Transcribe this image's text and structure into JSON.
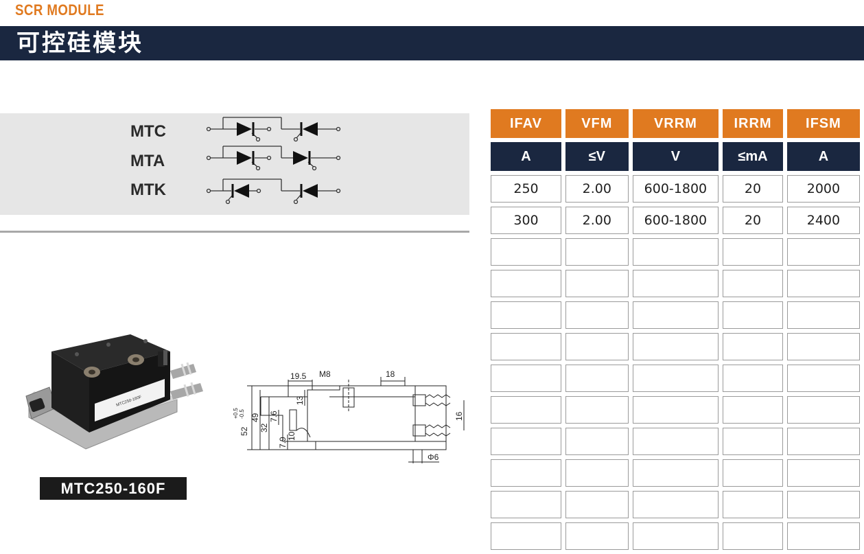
{
  "header": {
    "title_en": "SCR MODULE",
    "title_cn": "可控硅模块"
  },
  "types": [
    "MTC",
    "MTA",
    "MTK"
  ],
  "model": "MTC250-160F",
  "product_photo": {
    "label_text": "MTC250-160F"
  },
  "drawing": {
    "dim_19_5": "19.5",
    "dim_m8": "M8",
    "dim_18": "18",
    "dim_52": "52",
    "tol_plus": "+0.5",
    "tol_minus": "-0.5",
    "dim_49": "49",
    "dim_32": "32",
    "dim_7_6": "7.6",
    "dim_7_9": "7.9",
    "dim_10": "10",
    "dim_13": "13",
    "dim_16": "16",
    "dim_phi6": "Φ6"
  },
  "table": {
    "headers": [
      "IFAV",
      "VFM",
      "VRRM",
      "IRRM",
      "IFSM"
    ],
    "units": [
      "A",
      "≤V",
      "V",
      "≤mA",
      "A"
    ],
    "rows": [
      [
        "250",
        "2.00",
        "600-1800",
        "20",
        "2000"
      ],
      [
        "300",
        "2.00",
        "600-1800",
        "20",
        "2400"
      ],
      [
        "",
        "",
        "",
        "",
        ""
      ],
      [
        "",
        "",
        "",
        "",
        ""
      ],
      [
        "",
        "",
        "",
        "",
        ""
      ],
      [
        "",
        "",
        "",
        "",
        ""
      ],
      [
        "",
        "",
        "",
        "",
        ""
      ],
      [
        "",
        "",
        "",
        "",
        ""
      ],
      [
        "",
        "",
        "",
        "",
        ""
      ],
      [
        "",
        "",
        "",
        "",
        ""
      ],
      [
        "",
        "",
        "",
        "",
        ""
      ],
      [
        "",
        "",
        "",
        "",
        ""
      ]
    ]
  },
  "colors": {
    "accent_orange": "#e07a20",
    "navy": "#1a2740",
    "band_gray": "#e6e6e6"
  }
}
